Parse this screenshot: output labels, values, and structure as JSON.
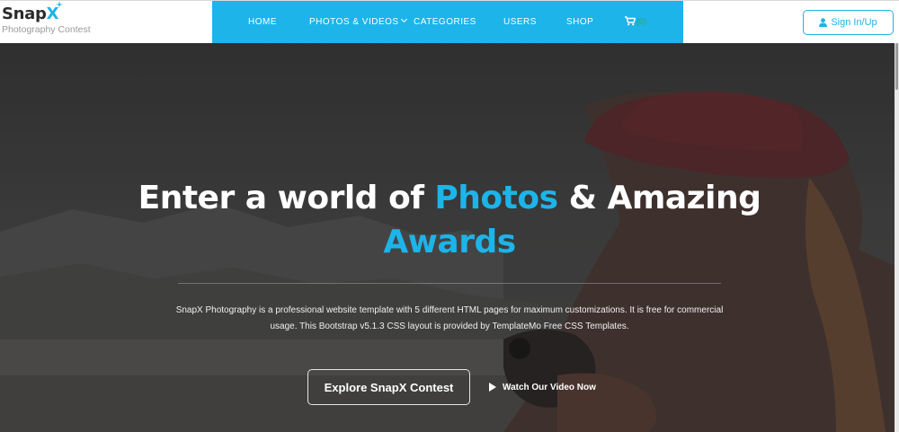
{
  "brand": {
    "name_main": "Snap",
    "name_accent": "X",
    "tagline": "Photography Contest"
  },
  "nav": {
    "items": [
      {
        "label": "HOME"
      },
      {
        "label": "PHOTOS & VIDEOS"
      },
      {
        "label": "CATEGORIES"
      },
      {
        "label": "USERS"
      },
      {
        "label": "SHOP"
      }
    ],
    "cart_count": "(0)"
  },
  "header": {
    "signin_label": "Sign In/Up"
  },
  "hero": {
    "headline_part1": "Enter a world of ",
    "headline_accent1": "Photos",
    "headline_part2": " & Amazing",
    "headline_accent2": "Awards",
    "description": "SnapX Photography is a professional website template with 5 different HTML pages for maximum customizations. It is free for commercial usage. This Bootstrap v5.1.3 CSS layout is provided by TemplateMo Free CSS Templates.",
    "primary_button": "Explore SnapX Contest",
    "video_button": "Watch Our Video Now"
  },
  "colors": {
    "accent": "#1cb4e9",
    "header_bg": "#ffffff",
    "hero_text": "#ffffff"
  },
  "icons": {
    "cart": "cart-icon",
    "user": "user-icon",
    "play": "play-icon",
    "dropdown": "chevron-down-icon"
  }
}
